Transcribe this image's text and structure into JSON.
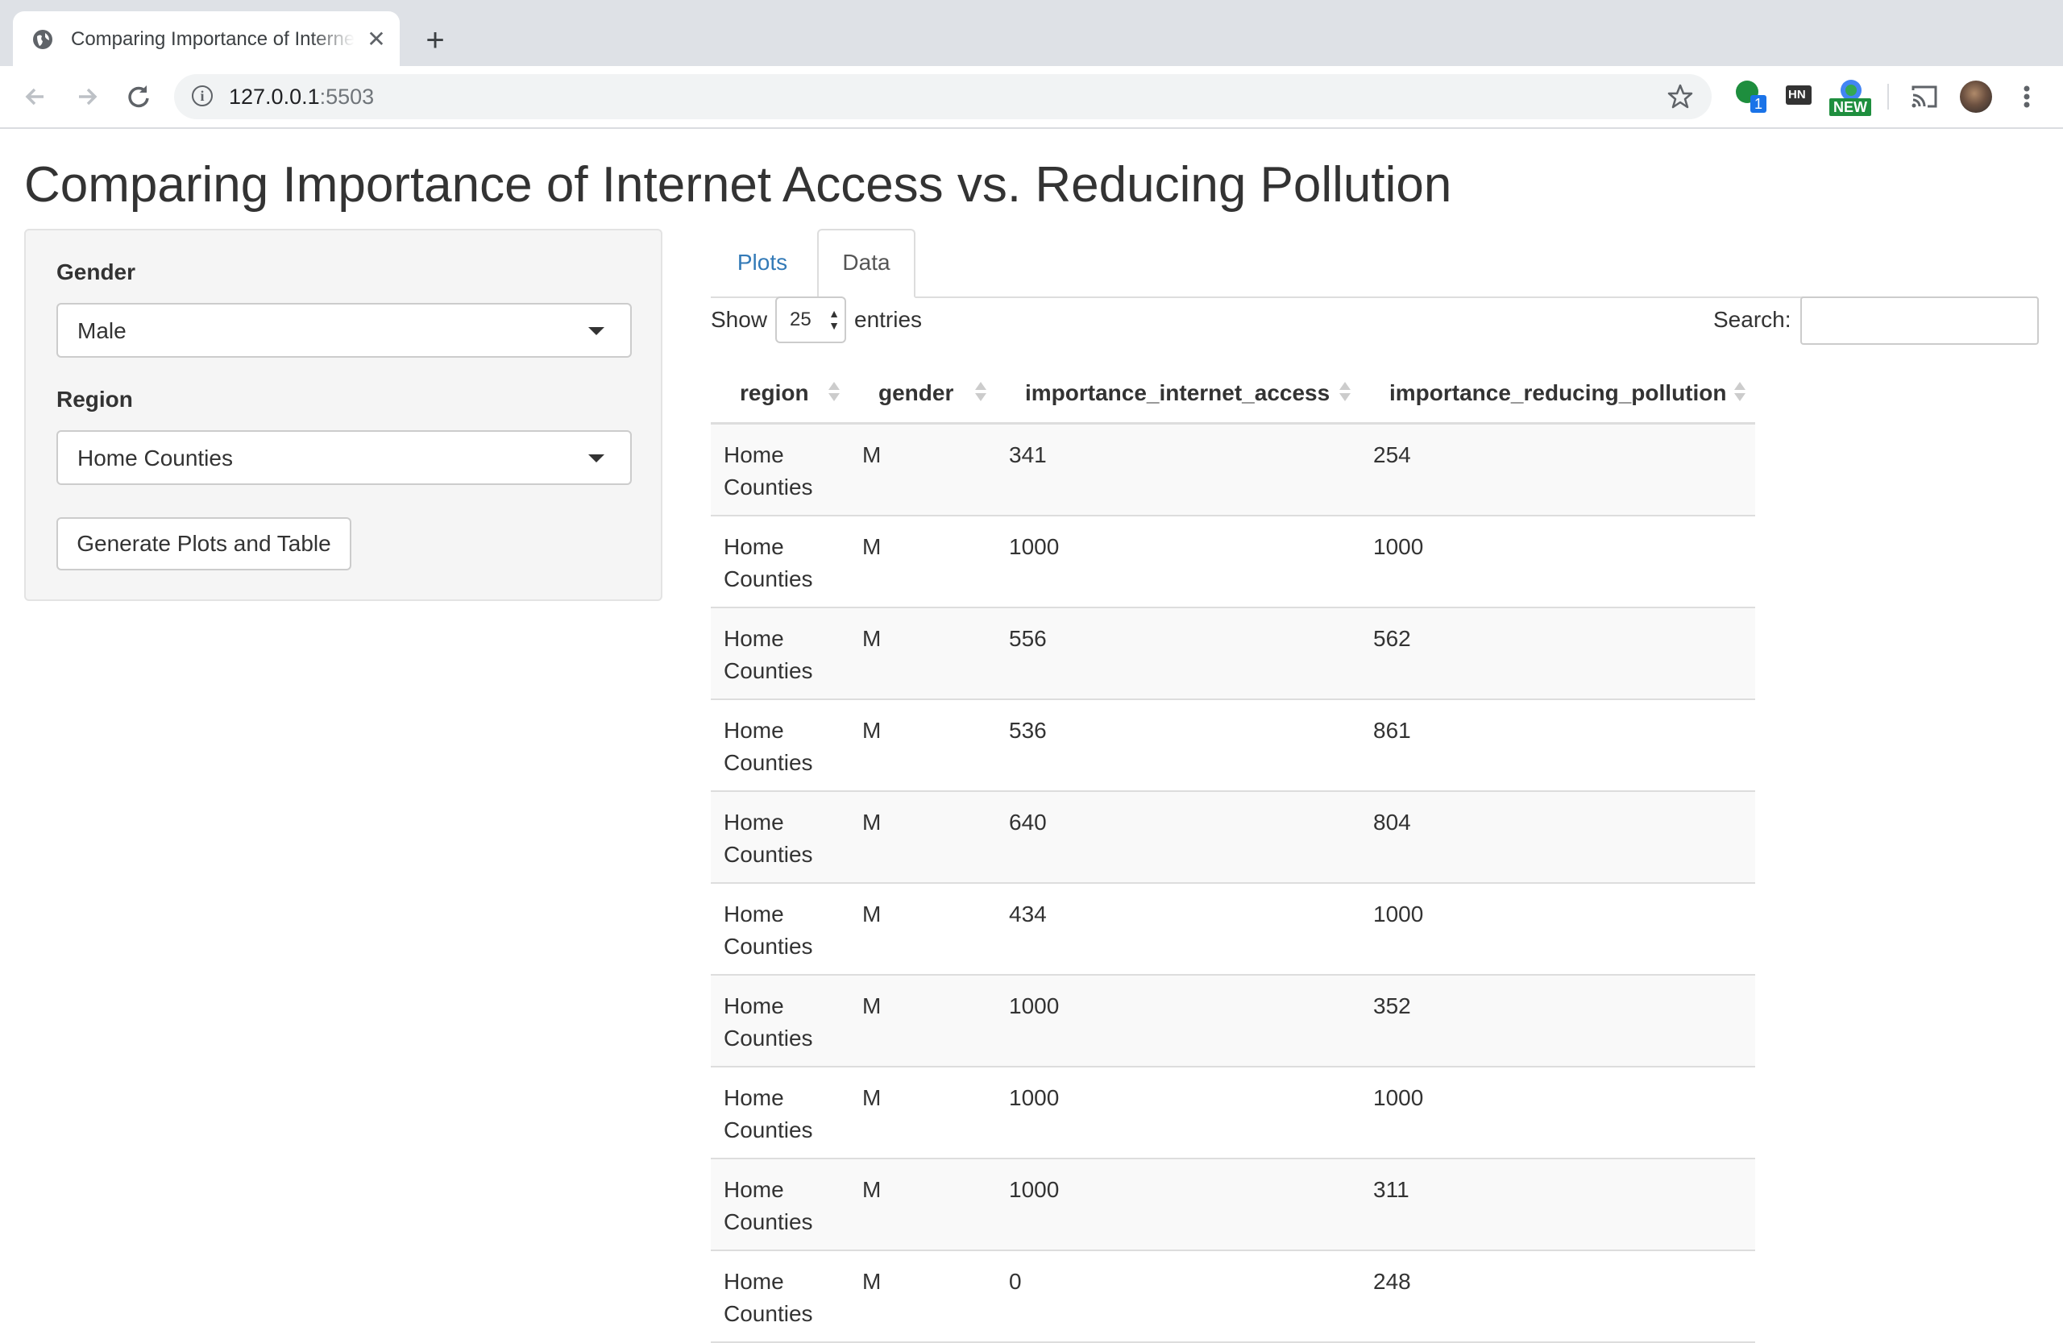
{
  "browser": {
    "tab_title": "Comparing Importance of Internet Access vs. Reducing Pollution",
    "close_glyph": "✕",
    "new_tab_glyph": "+",
    "url_host": "127.0.0.1",
    "url_port": ":5503",
    "extension_badge": "1",
    "extension_new_label": "NEW",
    "extension_hn_label": "HN"
  },
  "page": {
    "title": "Comparing Importance of Internet Access vs. Reducing Pollution"
  },
  "sidebar": {
    "gender_label": "Gender",
    "gender_value": "Male",
    "region_label": "Region",
    "region_value": "Home Counties",
    "generate_button": "Generate Plots and Table"
  },
  "tabs": {
    "plots": "Plots",
    "data": "Data",
    "active": "Data"
  },
  "table_controls": {
    "show_label": "Show",
    "page_length": "25",
    "entries_label": "entries",
    "search_label": "Search:",
    "search_value": ""
  },
  "table": {
    "columns": [
      "region",
      "gender",
      "importance_internet_access",
      "importance_reducing_pollution"
    ],
    "rows": [
      [
        "Home Counties",
        "M",
        "341",
        "254"
      ],
      [
        "Home Counties",
        "M",
        "1000",
        "1000"
      ],
      [
        "Home Counties",
        "M",
        "556",
        "562"
      ],
      [
        "Home Counties",
        "M",
        "536",
        "861"
      ],
      [
        "Home Counties",
        "M",
        "640",
        "804"
      ],
      [
        "Home Counties",
        "M",
        "434",
        "1000"
      ],
      [
        "Home Counties",
        "M",
        "1000",
        "352"
      ],
      [
        "Home Counties",
        "M",
        "1000",
        "1000"
      ],
      [
        "Home Counties",
        "M",
        "1000",
        "311"
      ],
      [
        "Home Counties",
        "M",
        "0",
        "248"
      ]
    ]
  },
  "colors": {
    "link": "#337ab7",
    "chrome_bg": "#dee1e6",
    "extension_green": "#1e8e3e",
    "extension_badge_blue": "#1a73e8"
  }
}
